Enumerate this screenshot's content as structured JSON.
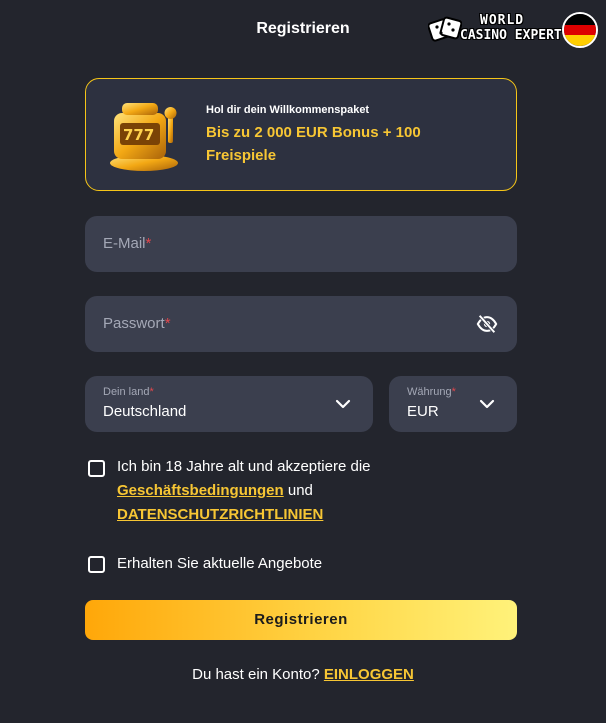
{
  "header": {
    "title": "Registrieren",
    "watermark_line1": "WORLD",
    "watermark_line2": "CASINO EXPERT",
    "flag_colors": [
      "#000000",
      "#dd0000",
      "#ffce00"
    ]
  },
  "bonus": {
    "small_text": "Hol dir dein Willkommenspaket",
    "big_text": "Bis zu 2 000 EUR Bonus + 100 Freispiele",
    "icon": "slot-machine-icon"
  },
  "form": {
    "email_placeholder": "E-Mail",
    "password_placeholder": "Passwort",
    "required_mark": "*",
    "country_label": "Dein land",
    "country_value": "Deutschland",
    "currency_label": "Währung",
    "currency_value": "EUR"
  },
  "terms": {
    "line1": "Ich bin 18 Jahre alt und akzeptiere die",
    "link_terms": "Geschäftsbedingungen",
    "and": "und",
    "link_privacy": "DATENSCHUTZRICHTLINIEN"
  },
  "offers": {
    "label": "Erhalten Sie aktuelle Angebote"
  },
  "actions": {
    "register_label": "Registrieren",
    "have_account": "Du hast ein Konto?",
    "login_label": "EINLOGGEN"
  },
  "colors": {
    "background": "#23252d",
    "field": "#3b3f4e",
    "accent_yellow": "#f7c634",
    "required_red": "#e0474c"
  }
}
